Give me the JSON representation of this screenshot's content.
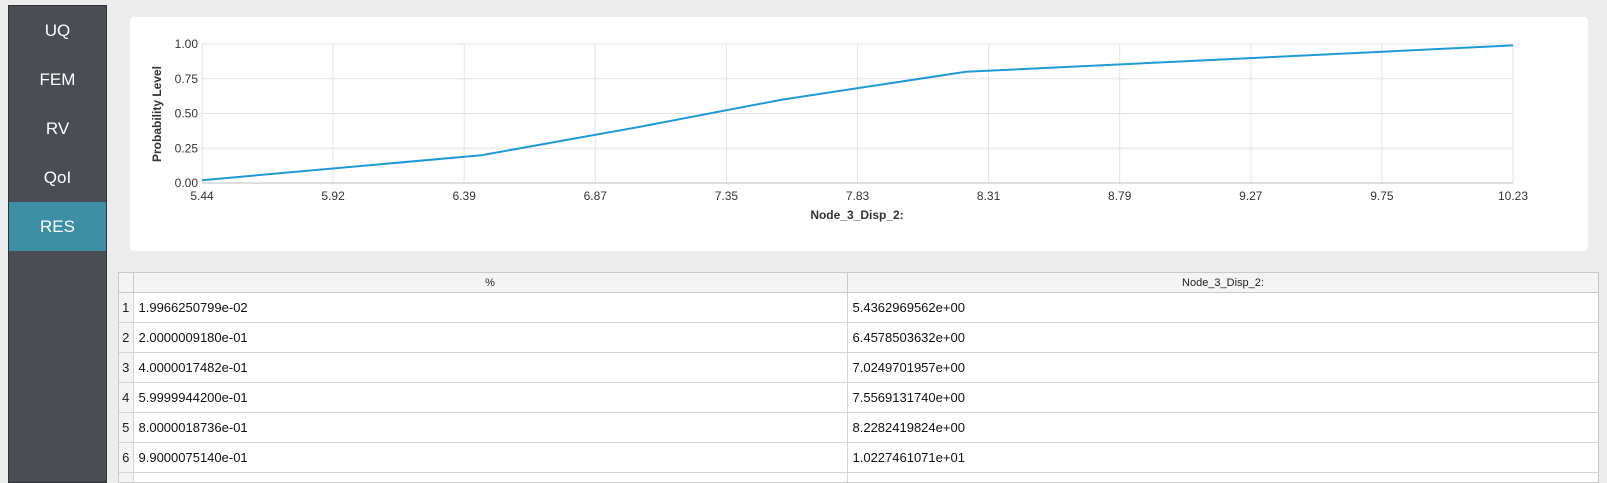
{
  "sidebar": {
    "items": [
      {
        "label": "UQ",
        "active": false
      },
      {
        "label": "FEM",
        "active": false
      },
      {
        "label": "RV",
        "active": false
      },
      {
        "label": "QoI",
        "active": false
      },
      {
        "label": "RES",
        "active": true
      }
    ],
    "active_color": "#3d8fa6"
  },
  "chart_data": {
    "type": "line",
    "xlabel": "Node_3_Disp_2:",
    "ylabel": "Probability Level",
    "x_ticks": [
      "5.44",
      "5.92",
      "6.39",
      "6.87",
      "7.35",
      "7.83",
      "8.31",
      "8.79",
      "9.27",
      "9.75",
      "10.23"
    ],
    "y_ticks": [
      "0.00",
      "0.25",
      "0.50",
      "0.75",
      "1.00"
    ],
    "xlim": [
      5.4363,
      10.2275
    ],
    "ylim": [
      0,
      1
    ],
    "grid": true,
    "line_color": "#1f9ad6",
    "series": [
      {
        "x": [
          5.4363,
          6.4579,
          7.025,
          7.5569,
          8.2282,
          10.2275
        ],
        "y": [
          0.019966,
          0.2,
          0.4,
          0.6,
          0.8,
          0.99
        ]
      }
    ]
  },
  "table": {
    "headers": [
      "%",
      "Node_3_Disp_2:"
    ],
    "rows": [
      {
        "index": "1",
        "cells": [
          "1.9966250799e-02",
          "5.4362969562e+00"
        ]
      },
      {
        "index": "2",
        "cells": [
          "2.0000009180e-01",
          "6.4578503632e+00"
        ]
      },
      {
        "index": "3",
        "cells": [
          "4.0000017482e-01",
          "7.0249701957e+00"
        ]
      },
      {
        "index": "4",
        "cells": [
          "5.9999944200e-01",
          "7.5569131740e+00"
        ]
      },
      {
        "index": "5",
        "cells": [
          "8.0000018736e-01",
          "8.2282419824e+00"
        ]
      },
      {
        "index": "6",
        "cells": [
          "9.9000075140e-01",
          "1.0227461071e+01"
        ]
      }
    ]
  }
}
